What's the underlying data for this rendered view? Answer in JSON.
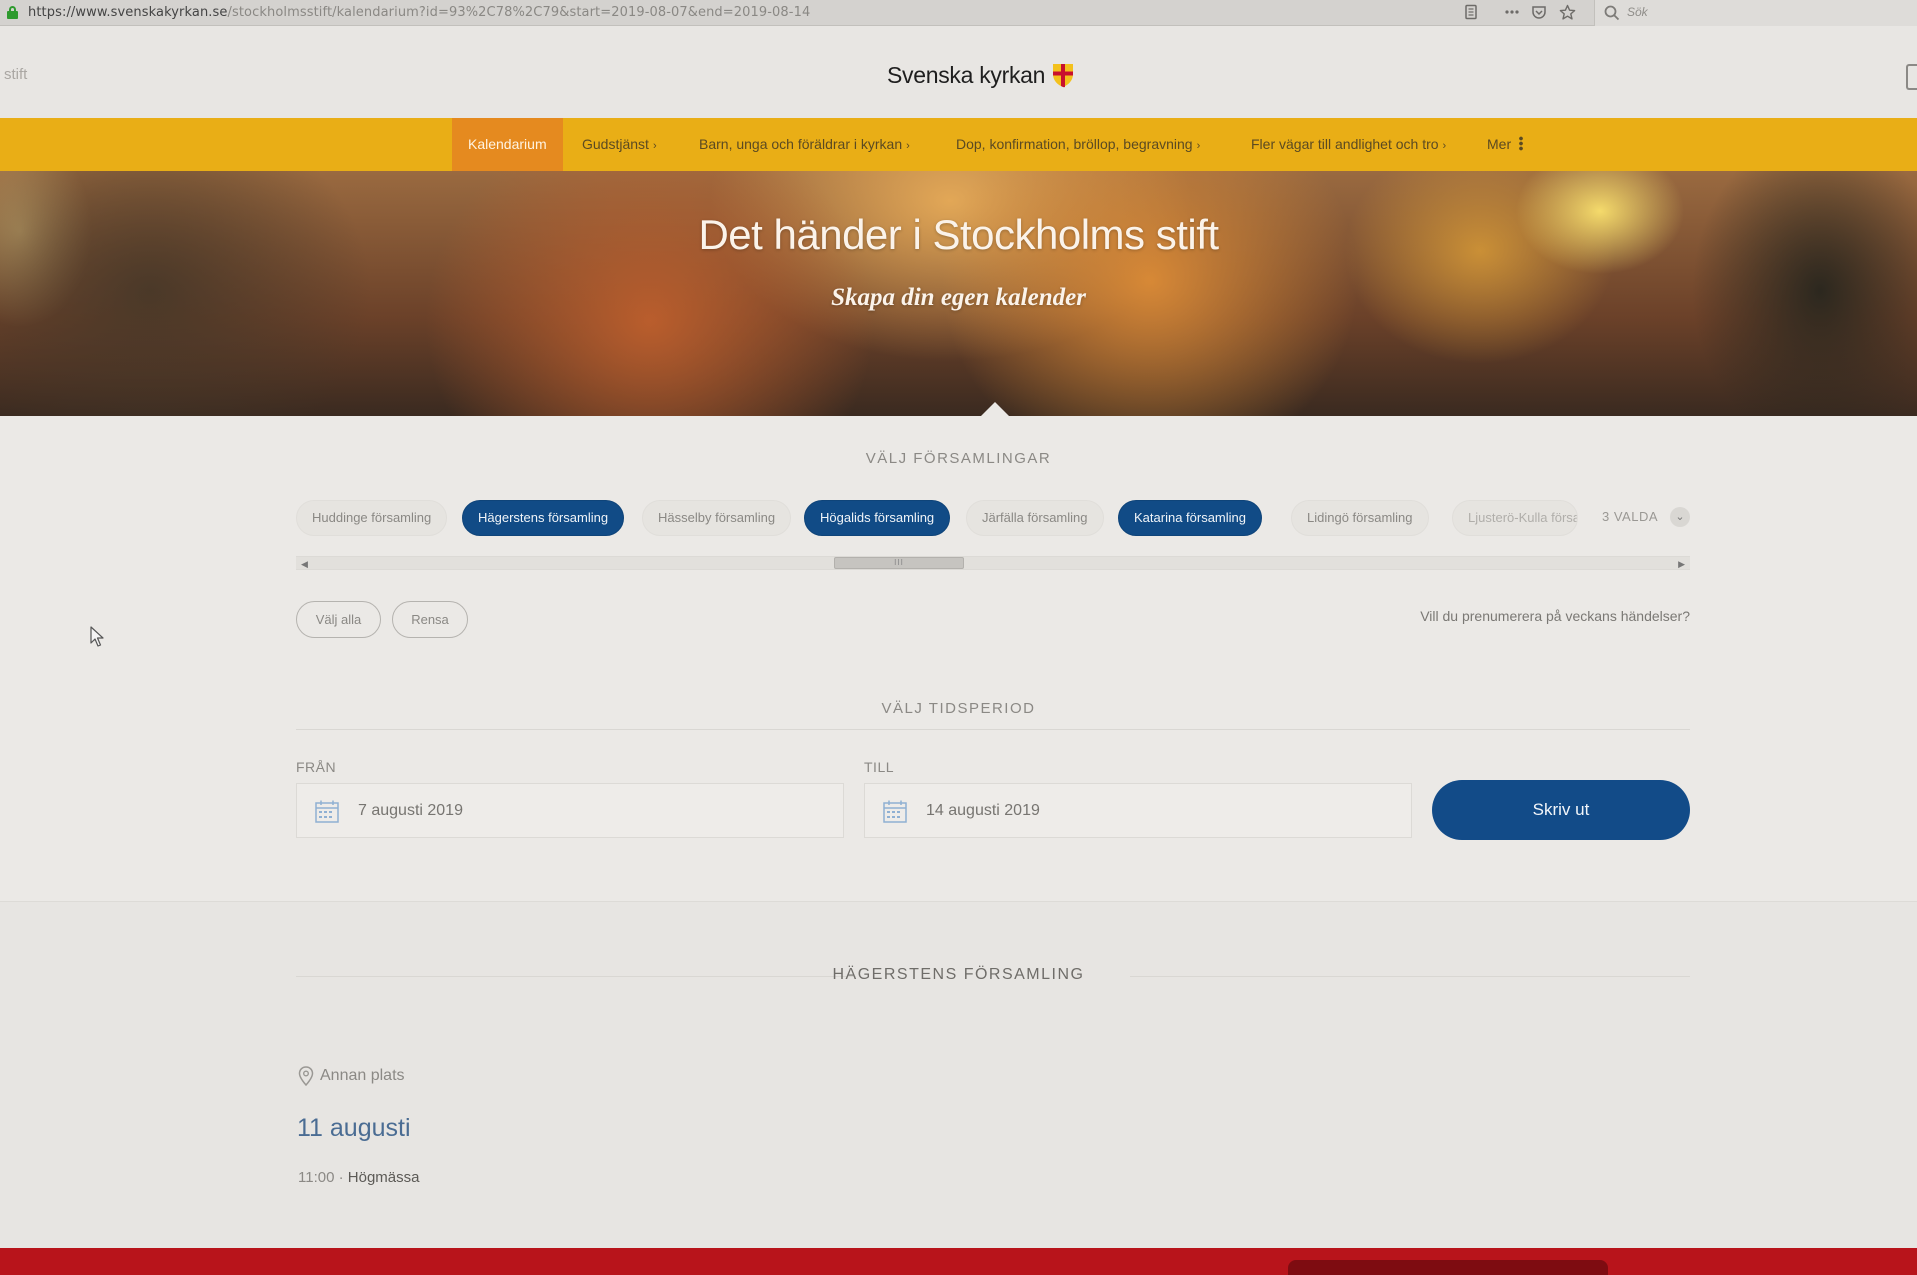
{
  "browser": {
    "url_host": "https://www.svenskakyrkan.se",
    "url_path": "/stockholmsstift/kalendarium?id=93%2C78%2C79&start=2019-08-07&end=2019-08-14",
    "search_placeholder": "Sök",
    "lock_color": "#2e9a2e",
    "icons": [
      "reader-icon",
      "more-icon",
      "pocket-icon",
      "bookmark-star-icon",
      "search-icon"
    ]
  },
  "header": {
    "section_label": "stift",
    "logo_text": "Svenska kyrkan"
  },
  "nav": {
    "items": [
      {
        "label": "Kalendarium",
        "active": true
      },
      {
        "label": "Gudstjänst",
        "chevron": "›"
      },
      {
        "label": "Barn, unga och föräldrar i kyrkan",
        "chevron": "›"
      },
      {
        "label": "Dop, konfirmation, bröllop, begravning",
        "chevron": "›"
      },
      {
        "label": "Fler vägar till andlighet och tro",
        "chevron": "›"
      },
      {
        "label": "Mer"
      }
    ],
    "bar_color": "#e9ae16",
    "active_color": "#e58a1f"
  },
  "hero": {
    "title": "Det händer i Stockholms stift",
    "subtitle": "Skapa din egen kalender"
  },
  "parish_filter": {
    "heading": "VÄLJ FÖRSAMLINGAR",
    "chips": [
      {
        "label": "Huddinge församling",
        "selected": false
      },
      {
        "label": "Hägerstens församling",
        "selected": true
      },
      {
        "label": "Hässelby församling",
        "selected": false
      },
      {
        "label": "Högalids församling",
        "selected": true
      },
      {
        "label": "Järfälla församling",
        "selected": false
      },
      {
        "label": "Katarina församling",
        "selected": true
      },
      {
        "label": "Lidingö församling",
        "selected": false
      },
      {
        "label": "Ljusterö-Kulla försa",
        "selected": false
      }
    ],
    "selected_count": "3 VALDA",
    "select_all": "Välj alla",
    "clear": "Rensa",
    "subscribe_link": "Vill du prenumerera på veckans händelser?",
    "selected_color": "#114b86"
  },
  "period": {
    "heading": "VÄLJ TIDSPERIOD",
    "from_label": "FRÅN",
    "from_value": "7 augusti 2019",
    "to_label": "TILL",
    "to_value": "14 augusti 2019",
    "print_button": "Skriv ut",
    "print_color": "#124b88"
  },
  "results": {
    "parish": "HÄGERSTENS FÖRSAMLING",
    "location": "Annan plats",
    "date": "11 augusti",
    "time": "11:00",
    "separator": "·",
    "event": "Högmässa"
  }
}
